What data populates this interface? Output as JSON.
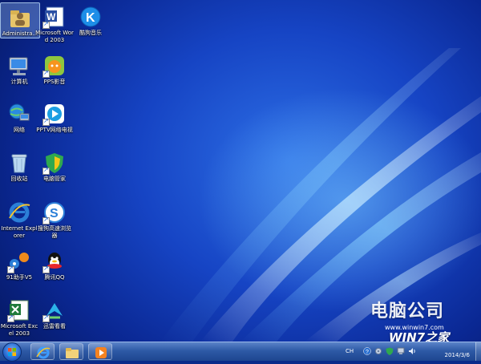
{
  "desktop_icons": [
    {
      "label": "Administra...",
      "icon": "user-folder-icon"
    },
    {
      "label": "Microsoft Word 2003",
      "icon": "word-icon"
    },
    {
      "label": "酷狗音乐",
      "icon": "kugou-icon"
    },
    {
      "label": "计算机",
      "icon": "computer-icon"
    },
    {
      "label": "PPS影音",
      "icon": "pps-icon"
    },
    {
      "label": "网络",
      "icon": "network-icon"
    },
    {
      "label": "PPTV网络电视",
      "icon": "pptv-icon"
    },
    {
      "label": "回收站",
      "icon": "recycle-bin-icon"
    },
    {
      "label": "电脑管家",
      "icon": "pc-manager-icon"
    },
    {
      "label": "Internet Explorer",
      "icon": "ie-icon"
    },
    {
      "label": "搜狗高速浏览器",
      "icon": "sogou-browser-icon"
    },
    {
      "label": "91助手V5",
      "icon": "91-assistant-icon"
    },
    {
      "label": "腾讯QQ",
      "icon": "qq-icon"
    },
    {
      "label": "Microsoft Excel 2003",
      "icon": "excel-icon"
    },
    {
      "label": "迅雷看看",
      "icon": "xunlei-icon"
    }
  ],
  "watermark": {
    "brand": "电脑公司",
    "site": "www.winwin7.com",
    "logo": "WIN7之家"
  },
  "taskbar": {
    "pinned": [
      "ie-icon",
      "folder-icon",
      "media-player-icon"
    ],
    "tray_text": "CH"
  },
  "clock": {
    "time": "",
    "date": "2014/3/6"
  },
  "colors": {
    "taskbar": "#2e5aa6",
    "desktop": "#1644c4"
  }
}
